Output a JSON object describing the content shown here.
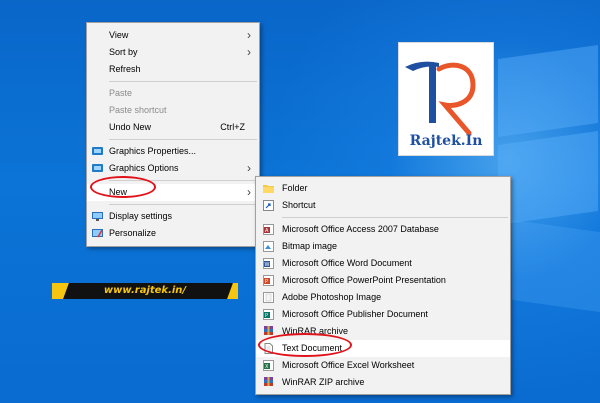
{
  "desktop": {
    "context_menu": {
      "items": [
        {
          "label": "View"
        },
        {
          "label": "Sort by"
        },
        {
          "label": "Refresh"
        },
        {
          "label": "Paste"
        },
        {
          "label": "Paste shortcut"
        },
        {
          "label": "Undo New",
          "shortcut": "Ctrl+Z"
        },
        {
          "label": "Graphics Properties..."
        },
        {
          "label": "Graphics Options"
        },
        {
          "label": "New"
        },
        {
          "label": "Display settings"
        },
        {
          "label": "Personalize"
        }
      ]
    },
    "new_submenu": {
      "items": [
        {
          "label": "Folder"
        },
        {
          "label": "Shortcut"
        },
        {
          "label": "Microsoft Office Access 2007 Database"
        },
        {
          "label": "Bitmap image"
        },
        {
          "label": "Microsoft Office Word Document"
        },
        {
          "label": "Microsoft Office PowerPoint Presentation"
        },
        {
          "label": "Adobe Photoshop Image"
        },
        {
          "label": "Microsoft Office Publisher Document"
        },
        {
          "label": "WinRAR archive"
        },
        {
          "label": "Text Document"
        },
        {
          "label": "Microsoft Office Excel Worksheet"
        },
        {
          "label": "WinRAR ZIP archive"
        }
      ]
    },
    "logo": {
      "text": "Rajtek.In"
    },
    "banner": {
      "text": "www.rajtek.in/"
    },
    "colors": {
      "desktop_blue": "#0a6bd0",
      "annotation_red": "#e0131b",
      "banner_yellow": "#f6c512"
    }
  }
}
